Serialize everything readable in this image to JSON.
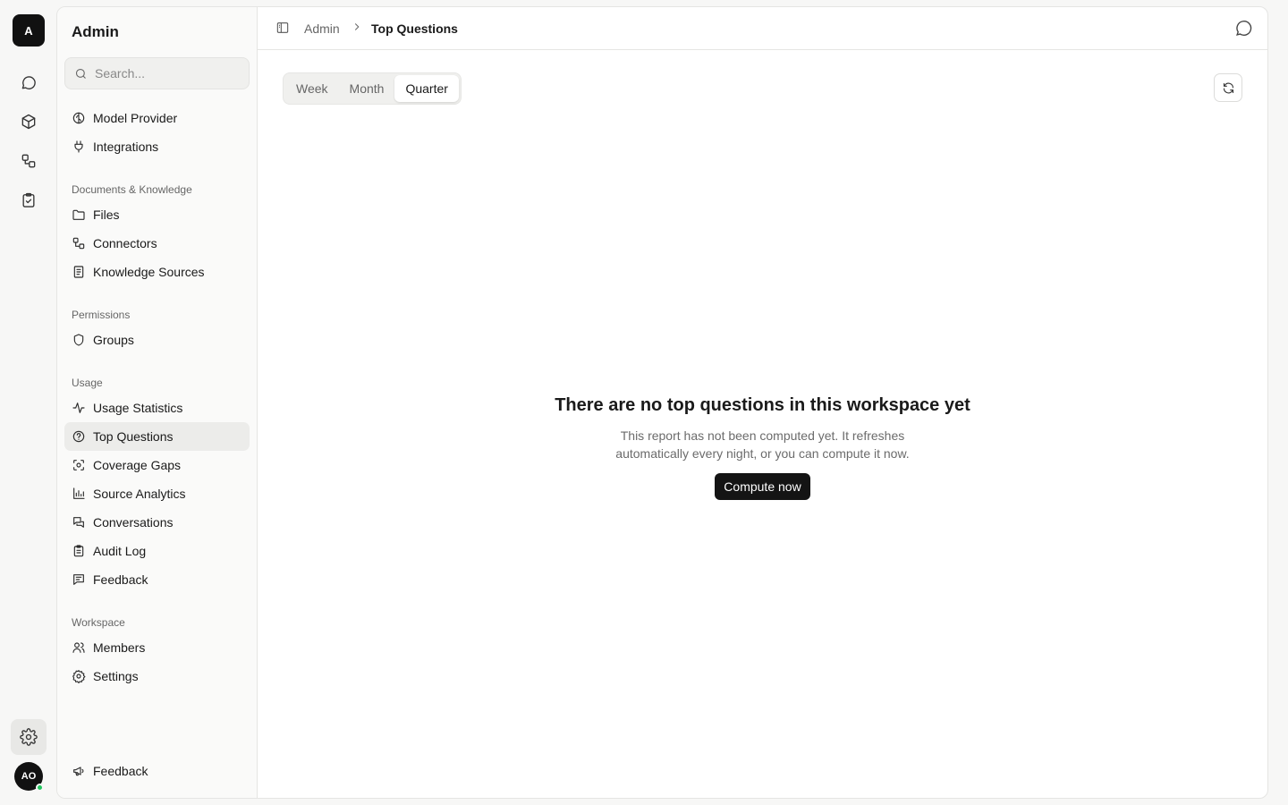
{
  "rail": {
    "workspace_initial": "A",
    "items": [
      {
        "icon": "chat-icon"
      },
      {
        "icon": "cube-icon"
      },
      {
        "icon": "workflow-icon"
      },
      {
        "icon": "clipboard-check-icon"
      }
    ],
    "settings_icon": "gear-icon",
    "avatar_initials": "AO",
    "status_color": "#22c55e"
  },
  "sidebar": {
    "title": "Admin",
    "search_placeholder": "Search...",
    "top_items": [
      {
        "label": "Model Provider",
        "icon": "brain-icon"
      },
      {
        "label": "Integrations",
        "icon": "plug-icon"
      }
    ],
    "sections": [
      {
        "label": "Documents & Knowledge",
        "items": [
          {
            "label": "Files",
            "icon": "folder-icon"
          },
          {
            "label": "Connectors",
            "icon": "connector-icon"
          },
          {
            "label": "Knowledge Sources",
            "icon": "book-icon"
          }
        ]
      },
      {
        "label": "Permissions",
        "items": [
          {
            "label": "Groups",
            "icon": "shield-icon"
          }
        ]
      },
      {
        "label": "Usage",
        "items": [
          {
            "label": "Usage Statistics",
            "icon": "activity-icon"
          },
          {
            "label": "Top Questions",
            "icon": "question-circle-icon",
            "active": true
          },
          {
            "label": "Coverage Gaps",
            "icon": "scan-icon"
          },
          {
            "label": "Source Analytics",
            "icon": "bar-chart-icon"
          },
          {
            "label": "Conversations",
            "icon": "messages-icon"
          },
          {
            "label": "Audit Log",
            "icon": "clipboard-list-icon"
          },
          {
            "label": "Feedback",
            "icon": "message-text-icon"
          }
        ]
      },
      {
        "label": "Workspace",
        "items": [
          {
            "label": "Members",
            "icon": "users-icon"
          },
          {
            "label": "Settings",
            "icon": "gear-icon"
          }
        ]
      }
    ],
    "footer_item": {
      "label": "Feedback",
      "icon": "megaphone-icon"
    }
  },
  "header": {
    "breadcrumb_root": "Admin",
    "breadcrumb_current": "Top Questions"
  },
  "main": {
    "tabs": [
      {
        "label": "Week"
      },
      {
        "label": "Month"
      },
      {
        "label": "Quarter",
        "active": true
      }
    ],
    "empty_title": "There are no top questions in this workspace yet",
    "empty_text": "This report has not been computed yet. It refreshes automatically every night, or you can compute it now.",
    "compute_label": "Compute now"
  }
}
